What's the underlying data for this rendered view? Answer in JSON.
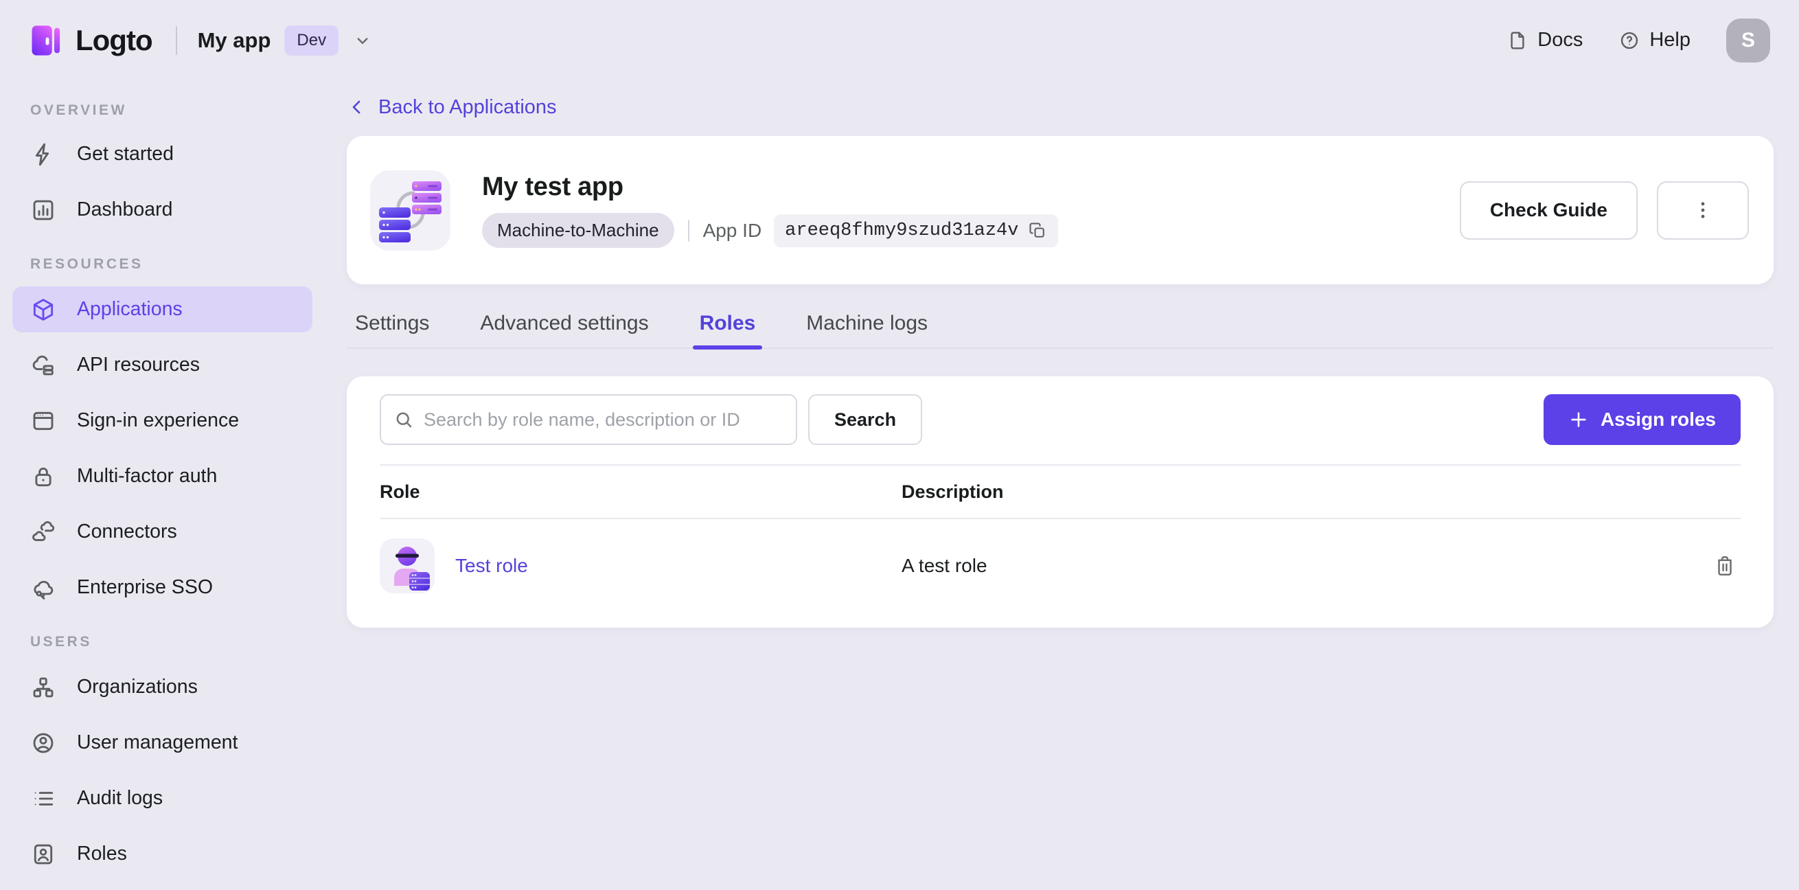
{
  "colors": {
    "primary": "#5C41E8",
    "primary_soft_bg": "#DCD3F8",
    "page_bg": "#EAE9F2",
    "card_bg": "#FFFFFF",
    "text_primary": "#191C1D",
    "text_secondary": "#5C5F60"
  },
  "topbar": {
    "brand": "Logto",
    "tenant_name": "My app",
    "env_badge": "Dev",
    "docs_label": "Docs",
    "help_label": "Help",
    "avatar_initial": "S"
  },
  "sidebar": {
    "sections": [
      {
        "label": "OVERVIEW",
        "items": [
          {
            "label": "Get started"
          },
          {
            "label": "Dashboard"
          }
        ]
      },
      {
        "label": "RESOURCES",
        "items": [
          {
            "label": "Applications",
            "active": true
          },
          {
            "label": "API resources"
          },
          {
            "label": "Sign-in experience"
          },
          {
            "label": "Multi-factor auth"
          },
          {
            "label": "Connectors"
          },
          {
            "label": "Enterprise SSO"
          }
        ]
      },
      {
        "label": "USERS",
        "items": [
          {
            "label": "Organizations"
          },
          {
            "label": "User management"
          },
          {
            "label": "Audit logs"
          },
          {
            "label": "Roles"
          }
        ]
      }
    ]
  },
  "main": {
    "back_link": "Back to Applications",
    "app": {
      "title": "My test app",
      "type_badge": "Machine-to-Machine",
      "app_id_label": "App ID",
      "app_id_value": "areeq8fhmy9szud31az4v",
      "check_guide_label": "Check Guide"
    },
    "tabs": [
      {
        "label": "Settings"
      },
      {
        "label": "Advanced settings"
      },
      {
        "label": "Roles",
        "active": true
      },
      {
        "label": "Machine logs"
      }
    ],
    "roles": {
      "search_placeholder": "Search by role name, description or ID",
      "search_button_label": "Search",
      "assign_button_label": "Assign roles",
      "columns": {
        "role": "Role",
        "description": "Description"
      },
      "rows": [
        {
          "role_name": "Test role",
          "description": "A test role"
        }
      ]
    }
  }
}
